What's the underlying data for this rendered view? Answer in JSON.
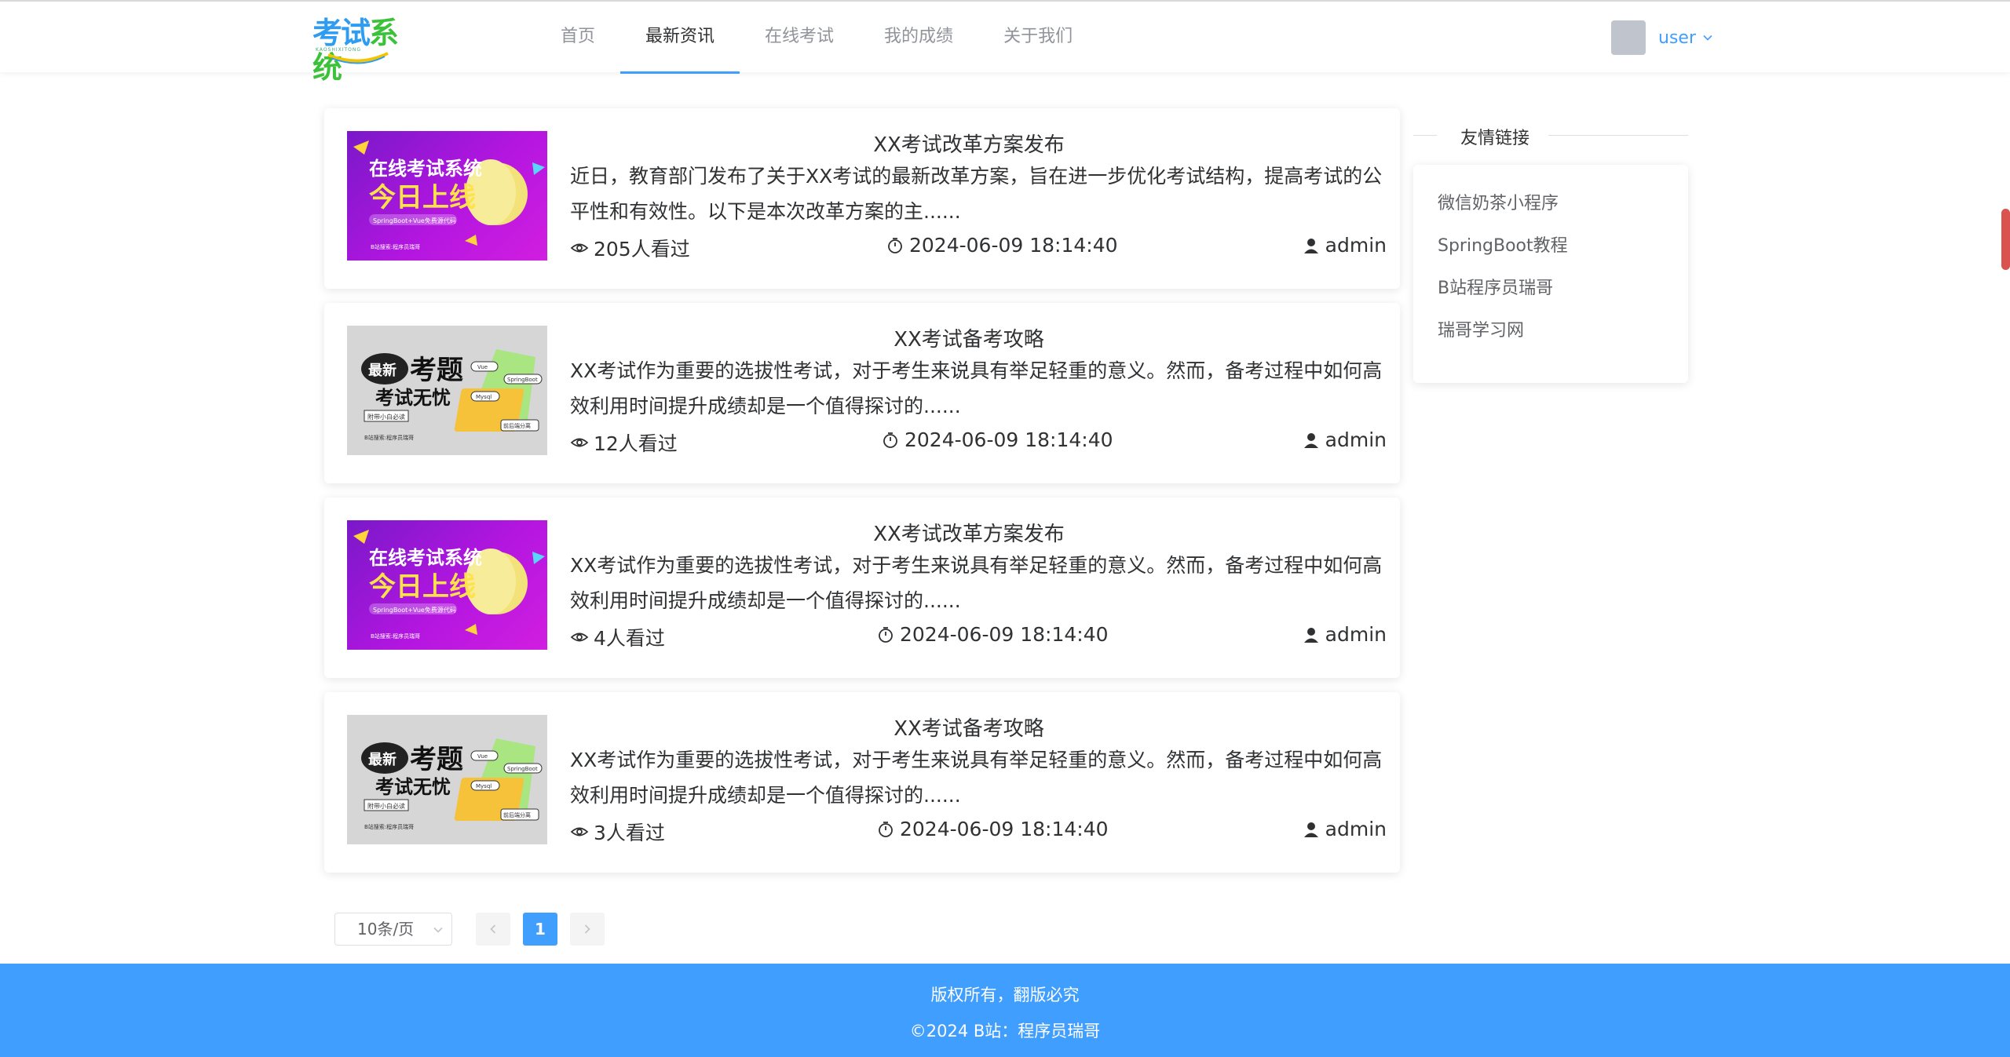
{
  "header": {
    "logo": {
      "char1": "考试",
      "char2": "系统",
      "sub": "KAOSHIXITONG"
    },
    "nav": [
      {
        "label": "首页",
        "active": false
      },
      {
        "label": "最新资讯",
        "active": true
      },
      {
        "label": "在线考试",
        "active": false
      },
      {
        "label": "我的成绩",
        "active": false
      },
      {
        "label": "关于我们",
        "active": false
      }
    ],
    "user": {
      "name": "user"
    }
  },
  "news": [
    {
      "title": "XX考试改革方案发布",
      "summary": "近日，教育部门发布了关于XX考试的最新改革方案，旨在进一步优化考试结构，提高考试的公平性和有效性。以下是本次改革方案的主......",
      "views": "205人看过",
      "time": "2024-06-09 18:14:40",
      "author": "admin",
      "thumb": "purple"
    },
    {
      "title": "XX考试备考攻略",
      "summary": "XX考试作为重要的选拔性考试，对于考生来说具有举足轻重的意义。然而，备考过程中如何高效利用时间提升成绩却是一个值得探讨的......",
      "views": "12人看过",
      "time": "2024-06-09 18:14:40",
      "author": "admin",
      "thumb": "gray"
    },
    {
      "title": "XX考试改革方案发布",
      "summary": "XX考试作为重要的选拔性考试，对于考生来说具有举足轻重的意义。然而，备考过程中如何高效利用时间提升成绩却是一个值得探讨的......",
      "views": "4人看过",
      "time": "2024-06-09 18:14:40",
      "author": "admin",
      "thumb": "purple"
    },
    {
      "title": "XX考试备考攻略",
      "summary": "XX考试作为重要的选拔性考试，对于考生来说具有举足轻重的意义。然而，备考过程中如何高效利用时间提升成绩却是一个值得探讨的......",
      "views": "3人看过",
      "time": "2024-06-09 18:14:40",
      "author": "admin",
      "thumb": "gray"
    }
  ],
  "thumbs": {
    "purple": {
      "line1": "在线考试系统",
      "line2": "今日上线",
      "tag": "SpringBoot+Vue免费源代码",
      "note": "B站搜索:程序员瑞哥"
    },
    "gray": {
      "badge": "最新",
      "big": "考题",
      "line2": "考试无忧",
      "tag1": "Vue",
      "tag2": "SpringBoot",
      "tag3": "Mysql",
      "tag4": "前后端分离",
      "box": "附带小白必读",
      "note": "B站搜索:程序员瑞哥"
    }
  },
  "sidebar": {
    "title": "友情链接",
    "links": [
      "微信奶茶小程序",
      "SpringBoot教程",
      "B站程序员瑞哥",
      "瑞哥学习网"
    ]
  },
  "pagination": {
    "page_size": "10条/页",
    "current": "1"
  },
  "footer": {
    "line1": "版权所有，翻版必究",
    "line2": "©2024 B站：程序员瑞哥"
  },
  "colors": {
    "primary": "#409eff",
    "nav_inactive": "#909399",
    "text": "#303133"
  },
  "icons": {
    "views": "eye-icon",
    "time": "timer-icon",
    "author": "user-icon"
  }
}
